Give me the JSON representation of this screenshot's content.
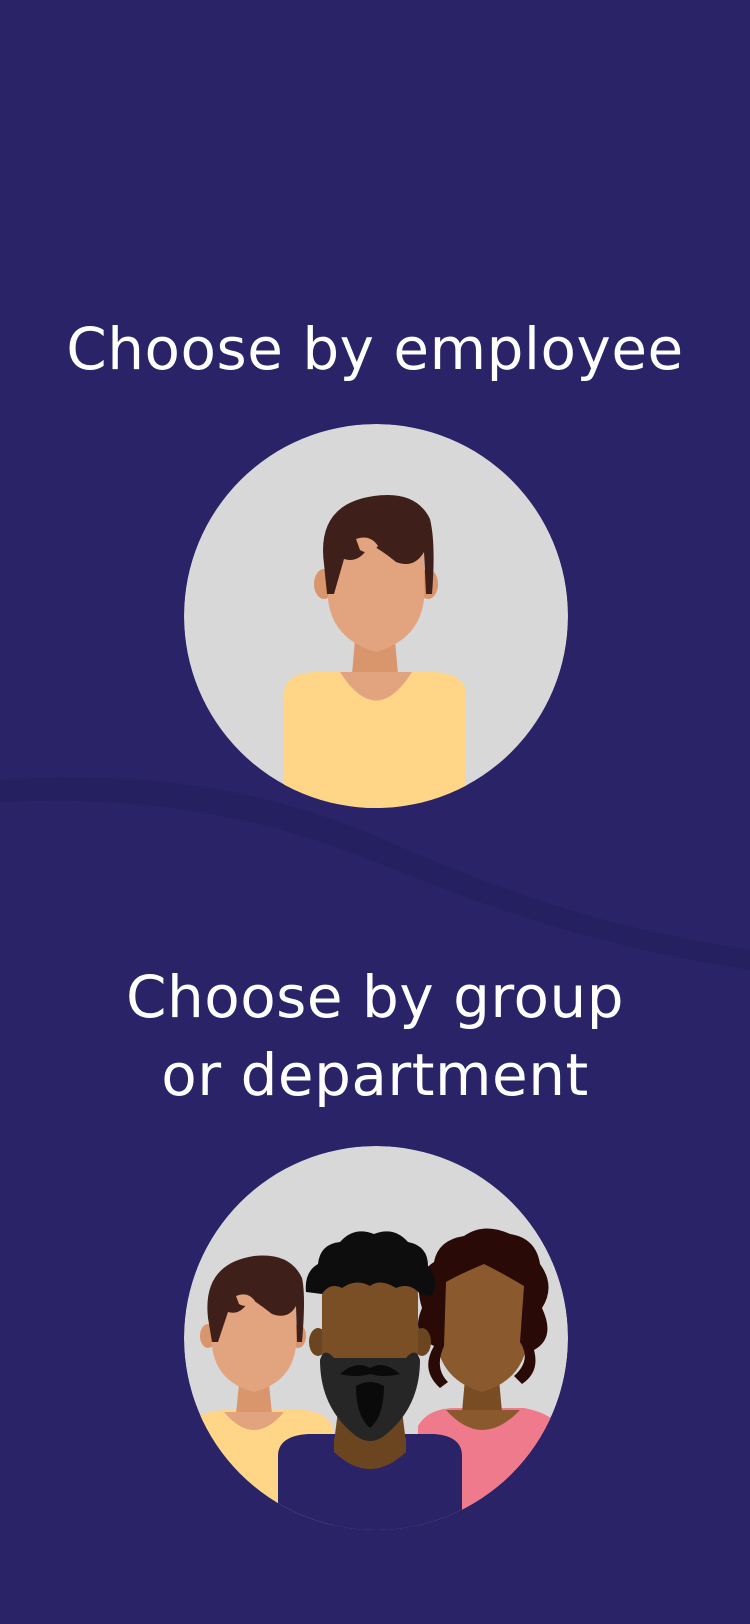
{
  "screen": {
    "background_color": "#2a2368",
    "wave_color": "#252060"
  },
  "employee_option": {
    "title": "Choose by employee",
    "avatar_icon": "person-avatar-icon"
  },
  "group_option": {
    "title_line1": "Choose by group",
    "title_line2": "or department",
    "avatar_icon": "group-avatar-icon"
  },
  "colors": {
    "avatar_bg": "#d8d8d8",
    "skin_light": "#e2a47f",
    "skin_dark": "#8a5a2e",
    "hair_brown": "#3e1f1a",
    "shirt_yellow": "#ffd587",
    "shirt_pink": "#ef7a8c",
    "shirt_navy": "#2a2368"
  }
}
